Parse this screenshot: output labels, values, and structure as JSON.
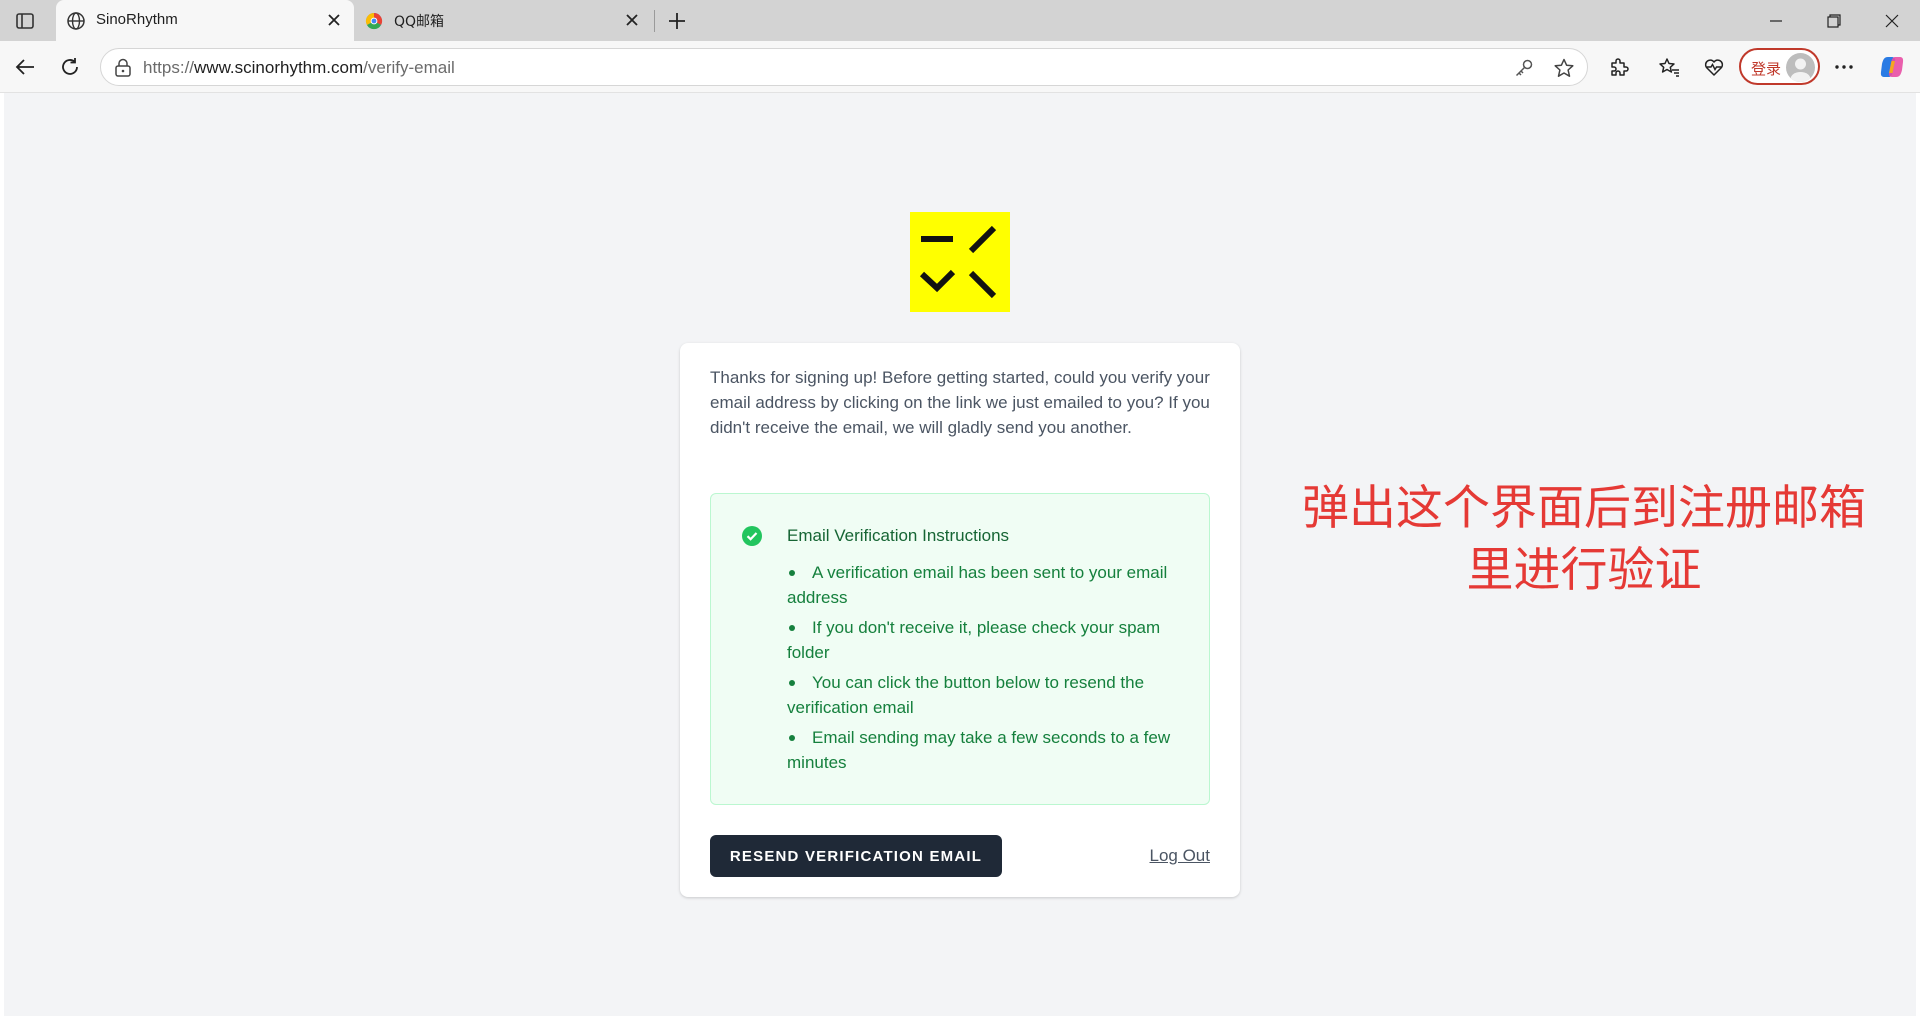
{
  "browser": {
    "tabs": [
      {
        "title": "SinoRhythm"
      },
      {
        "title": "QQ邮箱"
      }
    ],
    "url": {
      "scheme": "https://",
      "host": "www.scinorhythm.com",
      "path": "/verify-email"
    },
    "login_label": "登录"
  },
  "page": {
    "intro": "Thanks for signing up! Before getting started, could you verify your email address by clicking on the link we just emailed to you? If you didn't receive the email, we will gladly send you another.",
    "notice": {
      "title": "Email Verification Instructions",
      "items": [
        "A verification email has been sent to your email address",
        "If you don't receive it, please check your spam folder",
        "You can click the button below to resend the verification email",
        "Email sending may take a few seconds to a few minutes"
      ]
    },
    "resend_label": "RESEND VERIFICATION EMAIL",
    "logout_label": "Log Out"
  },
  "annotation": {
    "line1": "弹出这个界面后到注册邮箱",
    "line2": "里进行验证"
  },
  "colors": {
    "logo_bg": "#ffff00",
    "notice_bg": "#f0fdf4",
    "notice_text": "#15803d",
    "button_bg": "#1f2937",
    "annotation": "#e53935"
  }
}
